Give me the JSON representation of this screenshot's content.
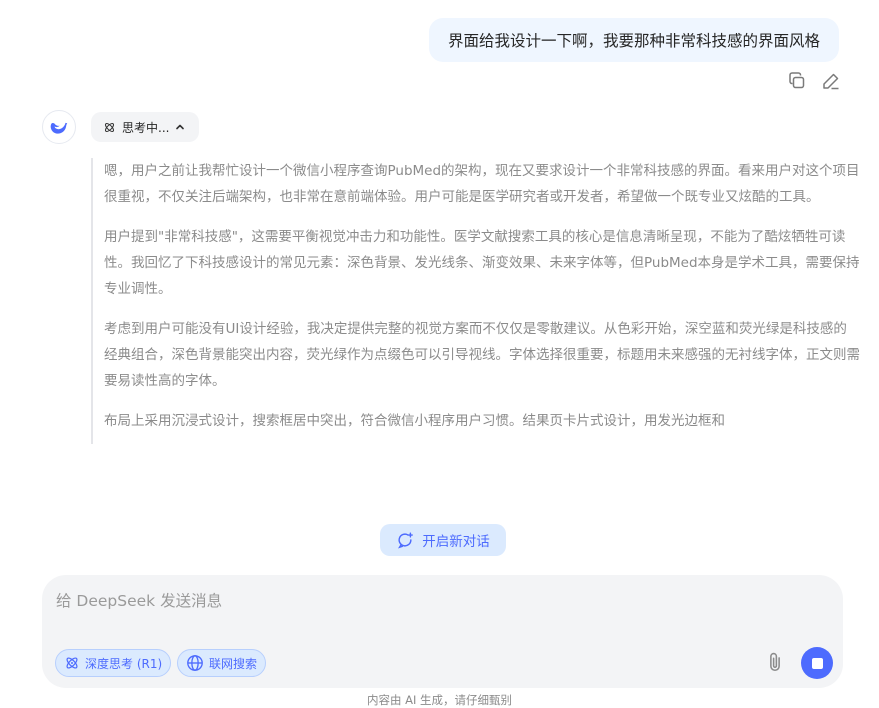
{
  "user_message": {
    "text": "界面给我设计一下啊，我要那种非常科技感的界面风格"
  },
  "message_actions": {
    "copy_icon": "copy-icon",
    "edit_icon": "edit-icon"
  },
  "assistant": {
    "avatar_icon": "deepseek-whale-icon",
    "thinking_label": "思考中...",
    "thinking_paragraphs": [
      "嗯，用户之前让我帮忙设计一个微信小程序查询PubMed的架构，现在又要求设计一个非常科技感的界面。看来用户对这个项目很重视，不仅关注后端架构，也非常在意前端体验。用户可能是医学研究者或开发者，希望做一个既专业又炫酷的工具。",
      "用户提到\"非常科技感\"，这需要平衡视觉冲击力和功能性。医学文献搜索工具的核心是信息清晰呈现，不能为了酷炫牺牲可读性。我回忆了下科技感设计的常见元素：深色背景、发光线条、渐变效果、未来字体等，但PubMed本身是学术工具，需要保持专业调性。",
      "考虑到用户可能没有UI设计经验，我决定提供完整的视觉方案而不仅仅是零散建议。从色彩开始，深空蓝和荧光绿是科技感的经典组合，深色背景能突出内容，荧光绿作为点缀色可以引导视线。字体选择很重要，标题用未来感强的无衬线字体，正文则需要易读性高的字体。",
      "布局上采用沉浸式设计，搜索框居中突出，符合微信小程序用户习惯。结果页卡片式设计，用发光边框和"
    ]
  },
  "new_chat": {
    "label": "开启新对话"
  },
  "composer": {
    "placeholder": "给 DeepSeek 发送消息",
    "value": "",
    "deep_think_label": "深度思考 (R1)",
    "web_search_label": "联网搜索"
  },
  "footer": {
    "note": "内容由 AI 生成，请仔细甄别"
  },
  "colors": {
    "accent": "#4d6bfe",
    "chip_bg": "#dbeafe",
    "bubble_bg": "#eff6ff",
    "composer_bg": "#f3f4f6"
  }
}
